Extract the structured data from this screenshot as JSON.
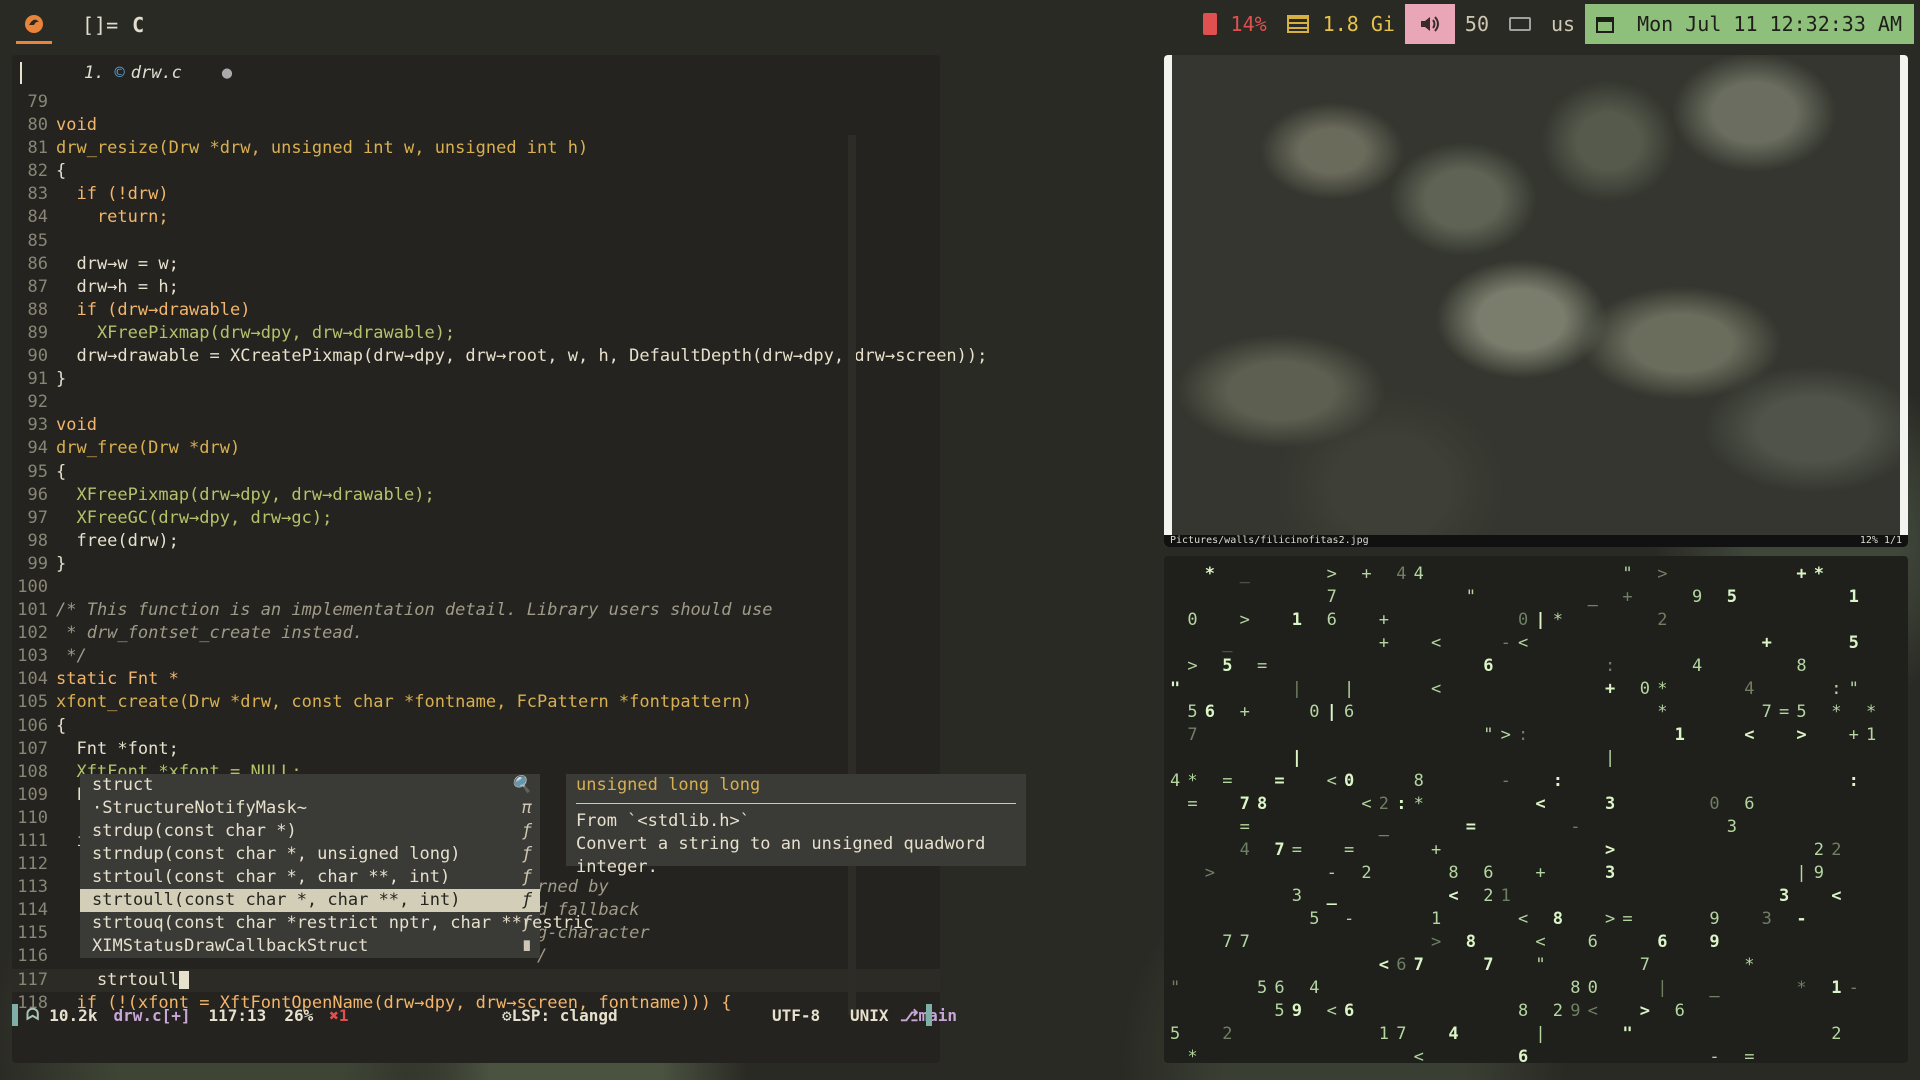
{
  "topbar": {
    "layout_symbol": "[]=",
    "client_icon": "C",
    "battery": "14%",
    "memory": "1.8 Gi",
    "volume": "50",
    "keyboard_layout": "us",
    "datetime": "Mon Jul 11 12:32:33 AM"
  },
  "editor": {
    "tab": {
      "number": "1.",
      "filename": "drw.c",
      "modified_dot": "●"
    },
    "lines": [
      {
        "n": "79",
        "t": ""
      },
      {
        "n": "80",
        "t": "void"
      },
      {
        "n": "81",
        "t": "drw_resize(Drw *drw, unsigned int w, unsigned int h)"
      },
      {
        "n": "82",
        "t": "{"
      },
      {
        "n": "83",
        "t": "  if (!drw)"
      },
      {
        "n": "84",
        "t": "    return;"
      },
      {
        "n": "85",
        "t": ""
      },
      {
        "n": "86",
        "t": "  drw→w = w;"
      },
      {
        "n": "87",
        "t": "  drw→h = h;"
      },
      {
        "n": "88",
        "t": "  if (drw→drawable)"
      },
      {
        "n": "89",
        "t": "    XFreePixmap(drw→dpy, drw→drawable);"
      },
      {
        "n": "90",
        "t": "  drw→drawable = XCreatePixmap(drw→dpy, drw→root, w, h, DefaultDepth(drw→dpy, drw→screen));"
      },
      {
        "n": "91",
        "t": "}"
      },
      {
        "n": "92",
        "t": ""
      },
      {
        "n": "93",
        "t": "void"
      },
      {
        "n": "94",
        "t": "drw_free(Drw *drw)"
      },
      {
        "n": "95",
        "t": "{"
      },
      {
        "n": "96",
        "t": "  XFreePixmap(drw→dpy, drw→drawable);"
      },
      {
        "n": "97",
        "t": "  XFreeGC(drw→dpy, drw→gc);"
      },
      {
        "n": "98",
        "t": "  free(drw);"
      },
      {
        "n": "99",
        "t": "}"
      },
      {
        "n": "100",
        "t": ""
      },
      {
        "n": "101",
        "t": "/* This function is an implementation detail. Library users should use"
      },
      {
        "n": "102",
        "t": " * drw_fontset_create instead."
      },
      {
        "n": "103",
        "t": " */"
      },
      {
        "n": "104",
        "t": "static Fnt *"
      },
      {
        "n": "105",
        "t": "xfont_create(Drw *drw, const char *fontname, FcPattern *fontpattern)"
      },
      {
        "n": "106",
        "t": "{"
      },
      {
        "n": "107",
        "t": "  Fnt *font;"
      },
      {
        "n": "108",
        "t": "  XftFont *xfont = NULL;"
      },
      {
        "n": "109",
        "t": "  F"
      },
      {
        "n": "110",
        "t": ""
      },
      {
        "n": "111",
        "t": "  i"
      },
      {
        "n": "112",
        "t": ""
      },
      {
        "n": "113",
        "t": "                                              urned by"
      },
      {
        "n": "114",
        "t": "                                              ed fallback"
      },
      {
        "n": "115",
        "t": "                                              ng-character"
      },
      {
        "n": "116",
        "t": "                                              */"
      },
      {
        "n": "117",
        "t": "    strtoull"
      },
      {
        "n": "118",
        "t": "  if (!(xfont = XftFontOpenName(drw→dpy, drw→screen, fontname))) {"
      }
    ],
    "completion": [
      {
        "label": "struct",
        "kind": "🔍"
      },
      {
        "label": "·StructureNotifyMask~",
        "kind": "π"
      },
      {
        "label": "strdup(const char *)",
        "kind": "ƒ"
      },
      {
        "label": "strndup(const char *, unsigned long)",
        "kind": "ƒ"
      },
      {
        "label": "strtoul(const char *, char **, int)",
        "kind": "ƒ"
      },
      {
        "label": "strtoull(const char *, char **, int)",
        "kind": "ƒ"
      },
      {
        "label": "strtouq(const char *restrict nptr, char **restric",
        "kind": "ƒ"
      },
      {
        "label": "XIMStatusDrawCallbackStruct",
        "kind": "∎"
      }
    ],
    "doc": {
      "signature": "unsigned long long",
      "from": "From `<stdlib.h>`",
      "description": "Convert a string to an unsigned quadword integer."
    },
    "status": {
      "size": "10.2k",
      "file": "drw.c[+]",
      "position": "117:13",
      "percent": "26%",
      "errors": "1",
      "lsp": "LSP: clangd",
      "encoding": "UTF-8",
      "format": "UNIX",
      "branch": "main"
    }
  },
  "viewer": {
    "path": "Pictures/walls/filicinofitas2.jpg",
    "zoom": "12%",
    "count": "1/1"
  },
  "colors": {
    "accent_green": "#8ec07c",
    "battery_red": "#e05050",
    "memory_yellow": "#e8c24a",
    "volume_pink": "#e9a6b6"
  }
}
